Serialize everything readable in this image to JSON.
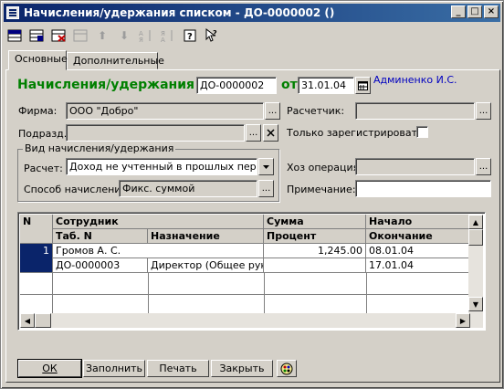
{
  "window": {
    "title": "Начисления/удержания списком - ДО-0000002 ()"
  },
  "title_buttons": {
    "minimize": "_",
    "maximize": "□",
    "close": "×"
  },
  "toolbar": {
    "icons": [
      "new-row",
      "new-copy",
      "delete-row",
      "edit-row",
      "move-up",
      "move-down",
      "sort-asc",
      "sort-desc",
      "help",
      "context-help"
    ]
  },
  "tabs": [
    {
      "label": "Основные",
      "active": true
    },
    {
      "label": "Дополнительные",
      "active": false
    }
  ],
  "doc": {
    "heading": "Начисления/удержания №",
    "number": "ДО-0000002",
    "date_label": "от",
    "date": "31.01.04",
    "author": "Админенко И.С."
  },
  "fields": {
    "firm_label": "Фирма:",
    "firm": "ООО \"Добро\"",
    "dept_label": "Подразд.:",
    "dept": "",
    "calc_label": "Расчетчик:",
    "calc": "",
    "register_only_label": "Только зарегистрировать"
  },
  "kind_group": {
    "title": "Вид начисления/удержания",
    "calc_label": "Расчет:",
    "calc_value": "Доход не учтенный в прошлых периодах",
    "method_label": "Способ начисления:",
    "method_value": "Фикс. суммой"
  },
  "hoz": {
    "label": "Хоз операция:",
    "value": ""
  },
  "note": {
    "label": "Примечание:",
    "value": ""
  },
  "grid": {
    "h_n": "N",
    "h_employee": "Сотрудник",
    "h_tab": "Таб. N",
    "h_purpose": "Назначение",
    "h_sum": "Сумма",
    "h_percent": "Процент",
    "h_start": "Начало",
    "h_end": "Окончание",
    "rows": [
      {
        "n": "1",
        "employee": "Громов А. С.",
        "tab": "ДО-0000003",
        "purpose": "Директор (Общее руков",
        "sum": "1,245.00",
        "percent": "",
        "start": "08.01.04",
        "end": "17.01.04"
      }
    ]
  },
  "buttons": {
    "ok": "ОК",
    "fill": "Заполнить",
    "print": "Печать",
    "close": "Закрыть"
  }
}
